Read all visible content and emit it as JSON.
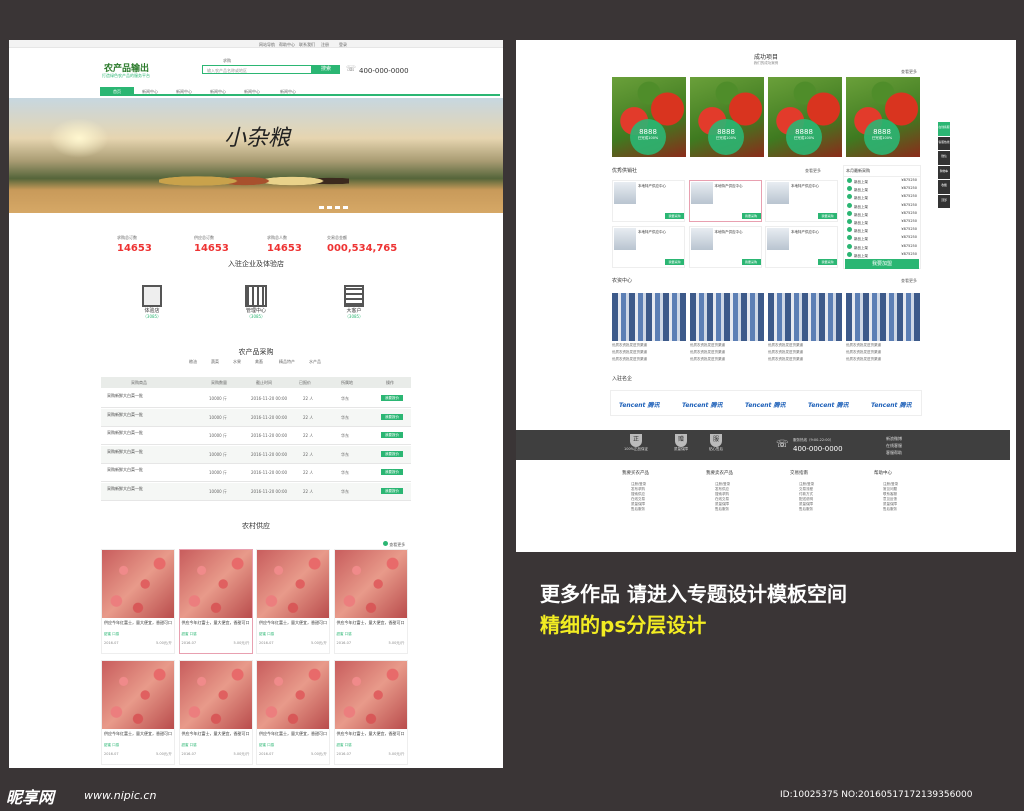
{
  "left": {
    "topbar_items": [
      "网站导航",
      "帮助中心",
      "联系我们",
      "注册",
      "登录"
    ],
    "logo_title": "农产品输出",
    "logo_sub": "打造绿色农产品的服务平台",
    "search_tab": "求购",
    "search_placeholder": "输入农产品名称或地区",
    "search_btn": "搜索",
    "phone": "400-000-0000",
    "nav": [
      "首页",
      "新闻中心",
      "新闻中心",
      "新闻中心",
      "新闻中心",
      "新闻中心"
    ],
    "banner_text": "小杂粮",
    "stats": [
      {
        "label": "求购总订数",
        "value": "14653"
      },
      {
        "label": "供应总订数",
        "value": "14653"
      },
      {
        "label": "求购总人数",
        "value": "14653"
      },
      {
        "label": "交易总金额",
        "value": "000,534,765"
      }
    ],
    "section1_title": "入驻企业及体验店",
    "stores": [
      {
        "name": "体验店",
        "count": "（3085）"
      },
      {
        "name": "管理中心",
        "count": "（3085）"
      },
      {
        "name": "大客户",
        "count": "（3085）"
      }
    ],
    "section2_title": "农产品采购",
    "cats": [
      "粮油",
      "蔬菜",
      "水果",
      "禽畜",
      "精品特产",
      "水产品"
    ],
    "table_headers": [
      "采购商品",
      "采购数量",
      "截止时间",
      "已报价",
      "所属地",
      "操作"
    ],
    "table_rows": [
      {
        "name": "采购新鲜大白菜一批",
        "qty": "10000 斤",
        "date": "2016-11-20 00:00",
        "quote": "22 人",
        "loc": "华东",
        "op": "我要报价"
      },
      {
        "name": "采购新鲜大白菜一批",
        "qty": "10000 斤",
        "date": "2016-11-20 00:00",
        "quote": "22 人",
        "loc": "华东",
        "op": "我要报价"
      },
      {
        "name": "采购新鲜大白菜一批",
        "qty": "10000 斤",
        "date": "2016-11-20 00:00",
        "quote": "22 人",
        "loc": "华东",
        "op": "我要报价"
      },
      {
        "name": "采购新鲜大白菜一批",
        "qty": "10000 斤",
        "date": "2016-11-20 00:00",
        "quote": "22 人",
        "loc": "华东",
        "op": "我要报价"
      },
      {
        "name": "采购新鲜大白菜一批",
        "qty": "10000 斤",
        "date": "2016-11-20 00:00",
        "quote": "22 人",
        "loc": "华东",
        "op": "我要报价"
      },
      {
        "name": "采购新鲜大白菜一批",
        "qty": "10000 斤",
        "date": "2016-11-20 00:00",
        "quote": "22 人",
        "loc": "华东",
        "op": "我要报价"
      }
    ],
    "section3_title": "农村供应",
    "more": "查看更多",
    "product_desc": "供应今年红富士，量大便宜，香甜可口",
    "product_tags": [
      "甜蜜",
      "口感"
    ],
    "product_date": "2016-07",
    "product_price": "5.00元/斤"
  },
  "right": {
    "s1_title": "成功项目",
    "s1_sub": "我们的成功案例",
    "more": "查看更多",
    "project_price": "8888",
    "project_status": "已完成100%",
    "s2_title": "优秀供销社",
    "coop_name": "本地特产供应中心",
    "coop_btn": "我要采购",
    "rank_title": "本月最新采购",
    "rank_items": [
      "新品上架",
      "新品上架",
      "新品上架",
      "新品上架",
      "新品上架",
      "新品上架",
      "新品上架",
      "新品上架",
      "新品上架",
      "新品上架"
    ],
    "rank_prices": [
      "¥875250",
      "¥875250",
      "¥875250",
      "¥875250",
      "¥875250",
      "¥875250",
      "¥875250",
      "¥875250",
      "¥875250",
      "¥875250"
    ],
    "rank_btn": "我要加盟",
    "s3_title": "农资中心",
    "news_item": "优质农资批发进货渠道",
    "s4_title": "入驻名企",
    "partners": [
      "Tencent 腾讯",
      "Tencent 腾讯",
      "Tencent 腾讯",
      "Tencent 腾讯",
      "Tencent 腾讯"
    ],
    "footer_badges": [
      {
        "icon": "正",
        "label": "100%正品保证"
      },
      {
        "icon": "赠",
        "label": "质量保障"
      },
      {
        "icon": "服",
        "label": "贴心售后"
      }
    ],
    "footer_phone_label": "服务热线（9:00-22:00）",
    "footer_phone": "400-000-0000",
    "footer_links": [
      "新浪微博",
      "在线客服",
      "客服帮助"
    ],
    "help_cols": [
      {
        "title": "我要买农产品",
        "items": [
          "注册/登录",
          "发布求购",
          "搜索供应",
          "在线交易",
          "质量保障",
          "售后服务"
        ]
      },
      {
        "title": "我要卖农产品",
        "items": [
          "注册/登录",
          "发布供应",
          "搜索求购",
          "在线交易",
          "质量保障",
          "售后服务"
        ]
      },
      {
        "title": "交易指南",
        "items": [
          "注册/登录",
          "交易流程",
          "付款方式",
          "配送说明",
          "质量保障",
          "售后服务"
        ]
      },
      {
        "title": "帮助中心",
        "items": [
          "注册/登录",
          "常见问题",
          "联系客服",
          "意见反馈",
          "质量保障",
          "售后服务"
        ]
      }
    ],
    "side_tabs": [
      "在线客服",
      "客服热线",
      "微信",
      "购物车",
      "收藏",
      "顶部"
    ]
  },
  "promo": {
    "line1": "更多作品 请进入专题设计模板空间",
    "line2": "精细的ps分层设计"
  },
  "watermark": {
    "logo": "昵享网",
    "url": "www.nipic.cn",
    "id": "ID:10025375 NO:20160517172139356000"
  },
  "colors": {
    "accent": "#2bb673",
    "promo_yellow": "#f2ec22"
  }
}
